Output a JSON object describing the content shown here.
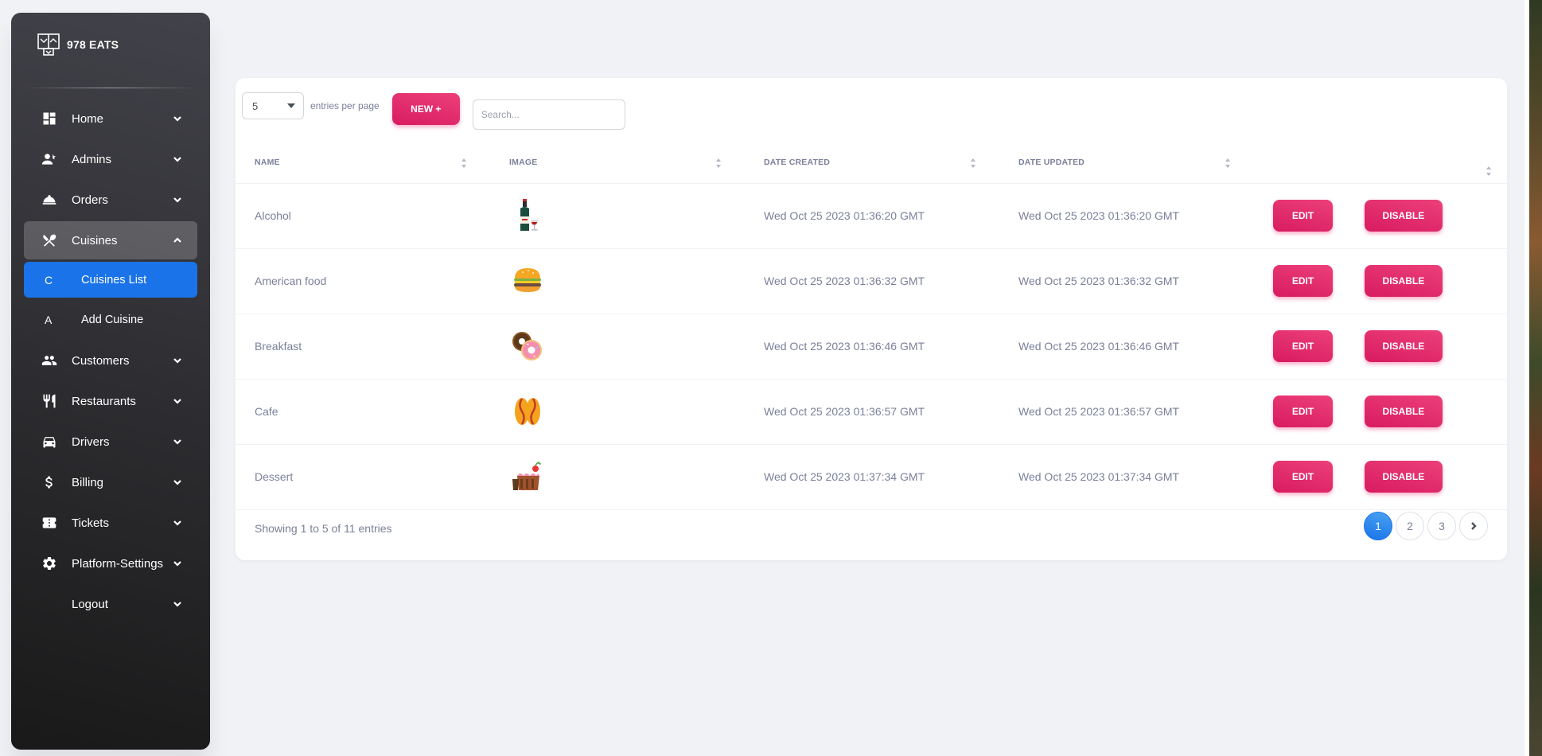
{
  "brand": {
    "name": "978 EATS"
  },
  "sidebar": {
    "items": [
      {
        "label": "Home",
        "icon": "dashboard-icon"
      },
      {
        "label": "Admins",
        "icon": "admins-icon"
      },
      {
        "label": "Orders",
        "icon": "room-service-icon"
      },
      {
        "label": "Cuisines",
        "icon": "utensils-crossed-icon",
        "expanded": true,
        "children": [
          {
            "letter": "C",
            "label": "Cuisines List",
            "active": true
          },
          {
            "letter": "A",
            "label": "Add Cuisine"
          }
        ]
      },
      {
        "label": "Customers",
        "icon": "customers-icon"
      },
      {
        "label": "Restaurants",
        "icon": "restaurant-icon"
      },
      {
        "label": "Drivers",
        "icon": "car-icon"
      },
      {
        "label": "Billing",
        "icon": "dollar-icon"
      },
      {
        "label": "Tickets",
        "icon": "ticket-icon"
      },
      {
        "label": "Platform-Settings",
        "icon": "gear-icon"
      },
      {
        "label": "Logout",
        "icon": ""
      }
    ]
  },
  "toolbar": {
    "entries_value": "5",
    "entries_label": "entries per page",
    "new_label": "NEW +",
    "search_placeholder": "Search..."
  },
  "table": {
    "columns": [
      "NAME",
      "IMAGE",
      "DATE CREATED",
      "DATE UPDATED",
      ""
    ],
    "rows": [
      {
        "name": "Alcohol",
        "image": "wine-bottle-icon",
        "created": "Wed Oct 25 2023 01:36:20 GMT",
        "updated": "Wed Oct 25 2023 01:36:20 GMT"
      },
      {
        "name": "American food",
        "image": "burger-icon",
        "created": "Wed Oct 25 2023 01:36:32 GMT",
        "updated": "Wed Oct 25 2023 01:36:32 GMT"
      },
      {
        "name": "Breakfast",
        "image": "donuts-icon",
        "created": "Wed Oct 25 2023 01:36:46 GMT",
        "updated": "Wed Oct 25 2023 01:36:46 GMT"
      },
      {
        "name": "Cafe",
        "image": "coffee-beans-icon",
        "created": "Wed Oct 25 2023 01:36:57 GMT",
        "updated": "Wed Oct 25 2023 01:36:57 GMT"
      },
      {
        "name": "Dessert",
        "image": "cake-icon",
        "created": "Wed Oct 25 2023 01:37:34 GMT",
        "updated": "Wed Oct 25 2023 01:37:34 GMT"
      }
    ],
    "edit_label": "EDIT",
    "disable_label": "DISABLE"
  },
  "footer": {
    "info": "Showing 1 to 5 of 11 entries",
    "pages": [
      "1",
      "2",
      "3"
    ],
    "active_page": "1"
  },
  "colors": {
    "accent": "#e91e63",
    "primary": "#1a73e8",
    "sidebar_dark": "#191919"
  }
}
